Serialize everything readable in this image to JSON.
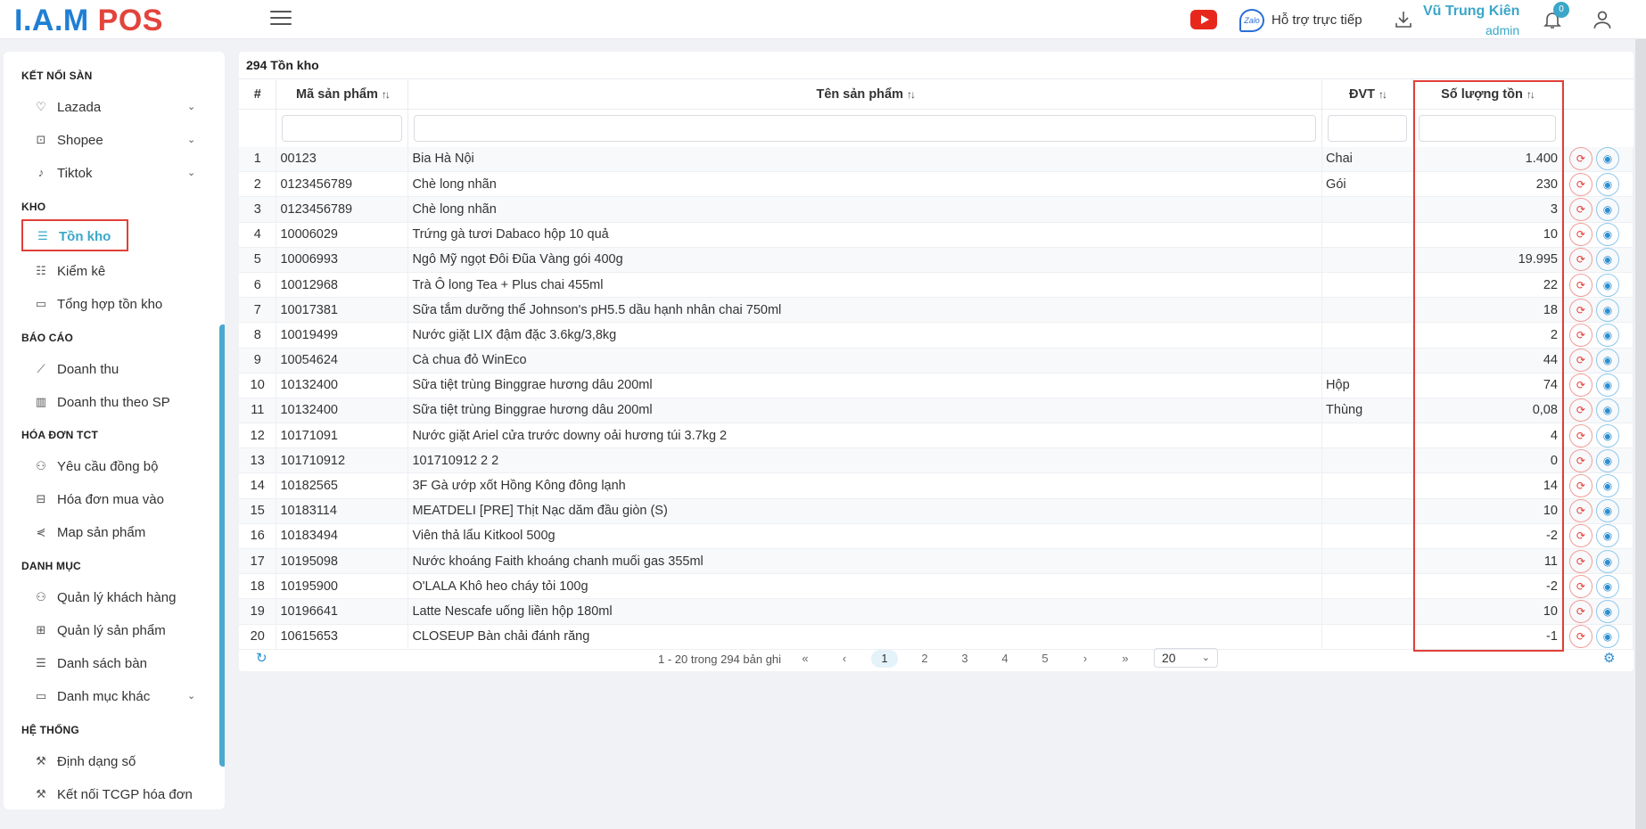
{
  "header": {
    "logo_part1": "I.A.M",
    "logo_part2": "POS",
    "support_label": "Hỗ trợ trực tiếp",
    "zalo_label": "Zalo",
    "user_name": "Vũ Trung Kiên",
    "user_role": "admin",
    "notification_count": "0"
  },
  "sidebar": {
    "sections": {
      "ket_noi_san": "KẾT NỐI SÀN",
      "kho": "KHO",
      "bao_cao": "BÁO CÁO",
      "hoa_don_tct": "HÓA ĐƠN TCT",
      "danh_muc": "DANH MỤC",
      "he_thong": "HỆ THỐNG"
    },
    "items": {
      "lazada": "Lazada",
      "shopee": "Shopee",
      "tiktok": "Tiktok",
      "ton_kho": "Tồn kho",
      "kiem_ke": "Kiểm kê",
      "tong_hop": "Tổng hợp tồn kho",
      "doanh_thu": "Doanh thu",
      "doanh_thu_sp": "Doanh thu theo SP",
      "yeu_cau": "Yêu cầu đồng bộ",
      "hoa_don_mua": "Hóa đơn mua vào",
      "map_sp": "Map sản phẩm",
      "ql_khach": "Quản lý khách hàng",
      "ql_sp": "Quản lý sản phẩm",
      "ds_ban": "Danh sách bàn",
      "dm_khac": "Danh mục khác",
      "dinh_dang": "Định dạng số",
      "ket_noi_tcgp": "Kết nối TCGP hóa đơn"
    }
  },
  "main": {
    "title": "294 Tồn kho",
    "columns": {
      "num": "#",
      "code": "Mã sản phẩm",
      "name": "Tên sản phẩm",
      "unit": "ĐVT",
      "qty": "Số lượng tồn"
    },
    "rows": [
      {
        "num": "1",
        "code": "00123",
        "name": "Bia Hà Nội",
        "unit": "Chai",
        "qty": "1.400"
      },
      {
        "num": "2",
        "code": "0123456789",
        "name": "Chè long nhãn",
        "unit": "Gói",
        "qty": "230"
      },
      {
        "num": "3",
        "code": "0123456789",
        "name": "Chè long nhãn",
        "unit": "",
        "qty": "3"
      },
      {
        "num": "4",
        "code": "10006029",
        "name": "Trứng gà tươi Dabaco hộp 10 quả",
        "unit": "",
        "qty": "10"
      },
      {
        "num": "5",
        "code": "10006993",
        "name": "Ngô Mỹ ngọt Đôi Đũa Vàng gói 400g",
        "unit": "",
        "qty": "19.995"
      },
      {
        "num": "6",
        "code": "10012968",
        "name": "Trà Ô long Tea + Plus chai 455ml",
        "unit": "",
        "qty": "22"
      },
      {
        "num": "7",
        "code": "10017381",
        "name": "Sữa tắm dưỡng thể Johnson's pH5.5 dầu hạnh nhân chai 750ml",
        "unit": "",
        "qty": "18"
      },
      {
        "num": "8",
        "code": "10019499",
        "name": "Nước giặt LIX đậm đặc 3.6kg/3,8kg",
        "unit": "",
        "qty": "2"
      },
      {
        "num": "9",
        "code": "10054624",
        "name": "Cà chua đỏ WinEco",
        "unit": "",
        "qty": "44"
      },
      {
        "num": "10",
        "code": "10132400",
        "name": "Sữa tiệt trùng Binggrae hương dâu 200ml",
        "unit": "Hộp",
        "qty": "74"
      },
      {
        "num": "11",
        "code": "10132400",
        "name": "Sữa tiệt trùng Binggrae hương dâu 200ml",
        "unit": "Thùng",
        "qty": "0,08"
      },
      {
        "num": "12",
        "code": "10171091",
        "name": "Nước giặt Ariel cửa trước downy oải hương túi 3.7kg 2",
        "unit": "",
        "qty": "4"
      },
      {
        "num": "13",
        "code": "101710912",
        "name": "101710912 2 2",
        "unit": "",
        "qty": "0"
      },
      {
        "num": "14",
        "code": "10182565",
        "name": "3F Gà ướp xốt Hồng Kông đông lạnh",
        "unit": "",
        "qty": "14"
      },
      {
        "num": "15",
        "code": "10183114",
        "name": "MEATDELI [PRE] Thịt Nạc dăm đầu giòn (S)",
        "unit": "",
        "qty": "10"
      },
      {
        "num": "16",
        "code": "10183494",
        "name": "Viên thả lẩu Kitkool 500g",
        "unit": "",
        "qty": "-2"
      },
      {
        "num": "17",
        "code": "10195098",
        "name": "Nước khoáng Faith khoáng chanh muối gas 355ml",
        "unit": "",
        "qty": "11"
      },
      {
        "num": "18",
        "code": "10195900",
        "name": "O'LALA Khô heo cháy tỏi 100g",
        "unit": "",
        "qty": "-2"
      },
      {
        "num": "19",
        "code": "10196641",
        "name": "Latte Nescafe uống liền hộp 180ml",
        "unit": "",
        "qty": "10"
      },
      {
        "num": "20",
        "code": "10615653",
        "name": "CLOSEUP Bàn chải đánh răng",
        "unit": "",
        "qty": "-1"
      }
    ]
  },
  "pager": {
    "range_text": "1 - 20 trong 294 bản ghi",
    "first": "«",
    "prev": "‹",
    "pages": [
      "1",
      "2",
      "3",
      "4",
      "5"
    ],
    "next": "›",
    "last": "»",
    "page_size": "20"
  }
}
